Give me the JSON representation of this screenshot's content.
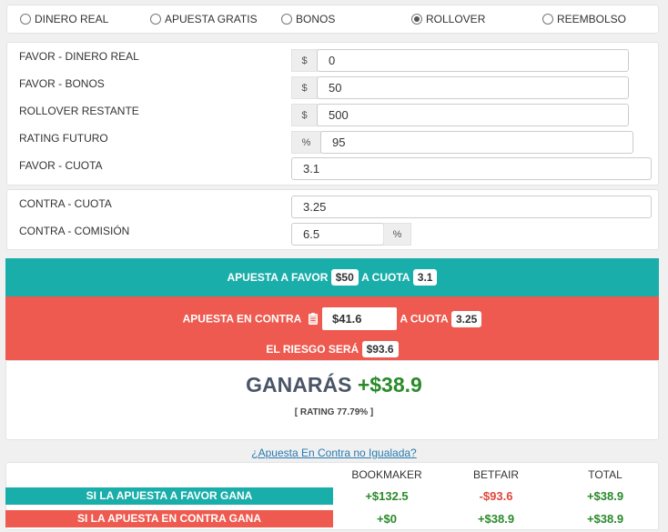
{
  "modes": [
    {
      "label": "DINERO REAL",
      "checked": false
    },
    {
      "label": "APUESTA GRATIS",
      "checked": false
    },
    {
      "label": "BONOS",
      "checked": false
    },
    {
      "label": "ROLLOVER",
      "checked": true
    },
    {
      "label": "REEMBOLSO",
      "checked": false
    }
  ],
  "favor": {
    "dinero_real": {
      "label": "FAVOR - DINERO REAL",
      "prefix": "$",
      "value": "0"
    },
    "bonos": {
      "label": "FAVOR - BONOS",
      "prefix": "$",
      "value": "50"
    },
    "rollover": {
      "label": "ROLLOVER RESTANTE",
      "prefix": "$",
      "value": "500"
    },
    "rating": {
      "label": "RATING FUTURO",
      "prefix": "%",
      "value": "95"
    },
    "cuota": {
      "label": "FAVOR - CUOTA",
      "value": "3.1"
    }
  },
  "contra": {
    "cuota": {
      "label": "CONTRA - CUOTA",
      "value": "3.25"
    },
    "comision": {
      "label": "CONTRA - COMISIÓN",
      "value": "6.5",
      "suffix": "%"
    }
  },
  "summary": {
    "favor_text": "APUESTA A FAVOR",
    "favor_amount": "$50",
    "a_cuota": "A CUOTA",
    "favor_cuota": "3.1",
    "contra_text": "APUESTA EN CONTRA",
    "contra_amount": "$41.6",
    "contra_cuota": "3.25",
    "riesgo_text": "EL RIESGO SERÁ",
    "riesgo_amount": "$93.6"
  },
  "result": {
    "win_word": "GANARÁS",
    "win_amount": "+$38.9",
    "rating": "[ RATING 77.79% ]"
  },
  "link": "¿Apuesta En Contra no Igualada?",
  "table": {
    "headers": [
      "BOOKMAKER",
      "BETFAIR",
      "TOTAL"
    ],
    "rows": [
      {
        "label": "SI LA APUESTA A FAVOR GANA",
        "bookmaker": "+$132.5",
        "betfair": "-$93.6",
        "total": "+$38.9"
      },
      {
        "label": "SI LA APUESTA EN CONTRA GANA",
        "bookmaker": "+$0",
        "betfair": "+$38.9",
        "total": "+$38.9"
      }
    ]
  },
  "colors": {
    "green": "#1aaeaa",
    "red": "#ee5a4f",
    "positive": "#2a8a2a",
    "negative": "#e0463c"
  }
}
